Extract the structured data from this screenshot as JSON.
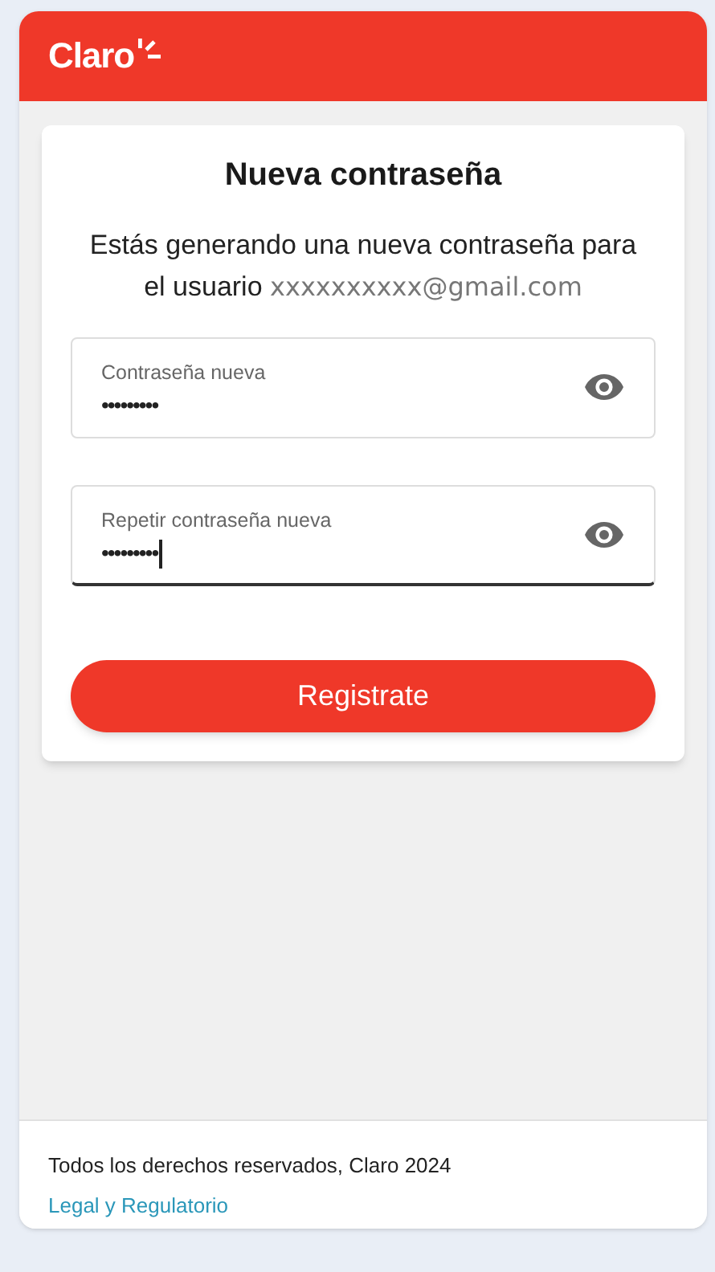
{
  "header": {
    "logo": "Claro"
  },
  "card": {
    "title": "Nueva contraseña",
    "intro": "Estás generando una nueva contraseña para el usuario",
    "email": "xxxxxxxxxx@gmail.com"
  },
  "fields": [
    {
      "label": "Contraseña nueva",
      "value": "•••••••••",
      "focused": false
    },
    {
      "label": "Repetir contraseña nueva",
      "value": "•••••••••",
      "focused": true
    }
  ],
  "submit": "Registrate",
  "footer": {
    "copyright": "Todos los derechos reservados, Claro 2024",
    "link": "Legal y Regulatorio"
  }
}
